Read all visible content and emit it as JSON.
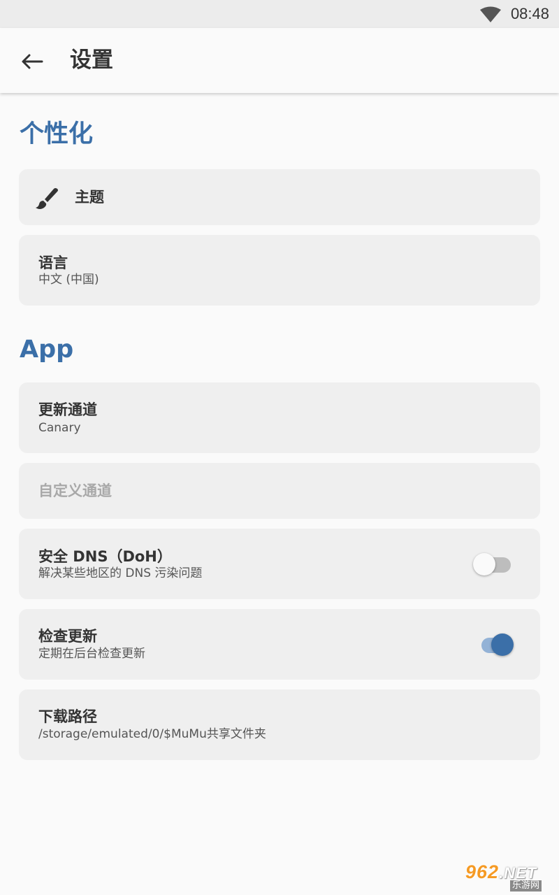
{
  "status_bar": {
    "time": "08:48",
    "wifi_icon": "wifi-icon"
  },
  "app_bar": {
    "back_icon": "arrow-back-icon",
    "title": "设置"
  },
  "sections": {
    "personalization": {
      "header": "个性化",
      "theme": {
        "title": "主题",
        "icon": "brush-icon"
      },
      "language": {
        "title": "语言",
        "subtitle": "中文 (中国)"
      }
    },
    "app": {
      "header": "App",
      "update_channel": {
        "title": "更新通道",
        "subtitle": "Canary"
      },
      "custom_channel": {
        "title": "自定义通道",
        "disabled": true
      },
      "secure_dns": {
        "title": "安全 DNS（DoH）",
        "subtitle": "解决某些地区的 DNS 污染问题",
        "enabled": false
      },
      "check_updates": {
        "title": "检查更新",
        "subtitle": "定期在后台检查更新",
        "enabled": true
      },
      "download_path": {
        "title": "下载路径",
        "subtitle": "/storage/emulated/0/$MuMu共享文件夹"
      }
    }
  },
  "watermark": {
    "brand": "962",
    "suffix": ".NET",
    "caption": "乐游网"
  },
  "colors": {
    "accent": "#3b6fa8",
    "card_bg": "#efefef",
    "page_bg": "#fafafa",
    "status_bar_bg": "#ececec"
  }
}
